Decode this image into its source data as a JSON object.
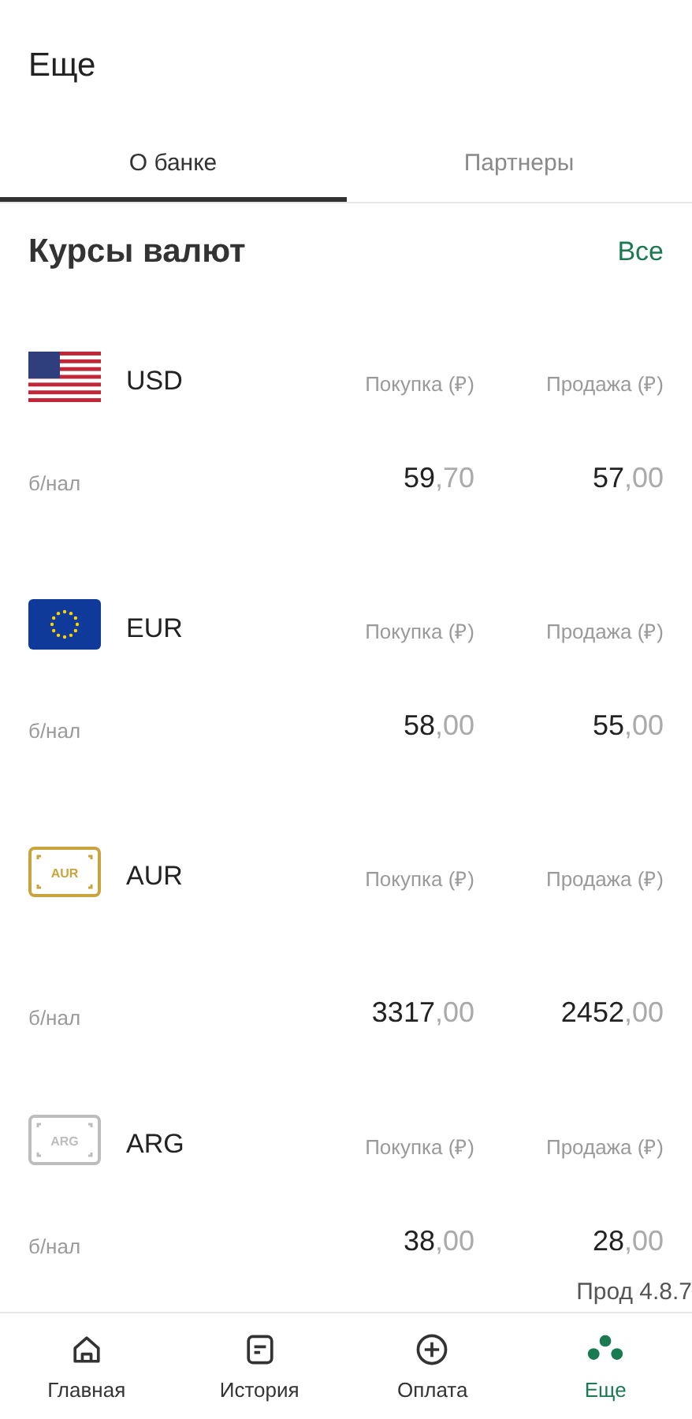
{
  "header": {
    "title": "Еще"
  },
  "tabs": [
    {
      "label": "О банке",
      "selected": true
    },
    {
      "label": "Партнеры",
      "selected": false
    }
  ],
  "section": {
    "title": "Курсы валют",
    "link": "Все"
  },
  "rates": [
    {
      "code": "USD",
      "kind": "us-flag",
      "buy_label": "Покупка (₽)",
      "sell_label": "Продажа (₽)",
      "type": "б/нал",
      "buy": "**59**,70",
      "sell": "**57**,00"
    },
    {
      "code": "EUR",
      "kind": "eu-flag",
      "buy_label": "Покупка (₽)",
      "sell_label": "Продажа (₽)",
      "type": "б/нал",
      "buy": "**58**,00",
      "sell": "**55**,00"
    },
    {
      "code": "AUR",
      "kind": "card",
      "badge": "AUR",
      "color": "#c9a43e",
      "buy_label": "Покупка (₽)",
      "sell_label": "Продажа (₽)",
      "type": "б/нал",
      "buy": "**3317**,00",
      "sell": "**2452**,00"
    },
    {
      "code": "ARG",
      "kind": "card",
      "badge": "ARG",
      "color": "#bdbdbd",
      "buy_label": "Покупка (₽)",
      "sell_label": "Продажа (₽)",
      "type": "б/нал",
      "buy": "**38**,00",
      "sell": "**28**,00"
    }
  ],
  "version": "Прод 4.8.7",
  "nav": [
    {
      "label": "Главная",
      "selected": false
    },
    {
      "label": "История",
      "selected": false
    },
    {
      "label": "Оплата",
      "selected": false
    },
    {
      "label": "Еще",
      "selected": true
    }
  ]
}
